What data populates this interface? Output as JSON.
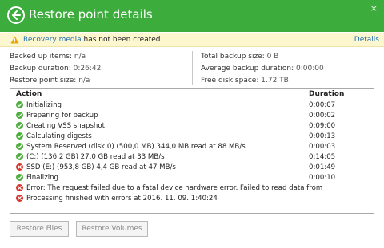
{
  "window": {
    "title": "Restore point details",
    "close_glyph": "×"
  },
  "notice": {
    "link_text": "Recovery media",
    "text": " has not been created",
    "details_label": "Details"
  },
  "summary": {
    "backed_up_items": {
      "label": "Backed up items:",
      "value": "n/a"
    },
    "backup_duration": {
      "label": "Backup duration:",
      "value": "0:26:42"
    },
    "restore_point_size": {
      "label": "Restore point size:",
      "value": "n/a"
    },
    "total_backup_size": {
      "label": "Total backup size:",
      "value": "0 B"
    },
    "average_backup_duration": {
      "label": "Average backup duration:",
      "value": "0:00:00"
    },
    "free_disk_space": {
      "label": "Free disk space:",
      "value": "1.72 TB"
    }
  },
  "log": {
    "columns": {
      "action": "Action",
      "duration": "Duration"
    },
    "rows": [
      {
        "status": "success",
        "text": "Initializing",
        "duration": "0:00:07"
      },
      {
        "status": "success",
        "text": "Preparing for backup",
        "duration": "0:00:02"
      },
      {
        "status": "success",
        "text": "Creating VSS snapshot",
        "duration": "0:09:00"
      },
      {
        "status": "success",
        "text": "Calculating digests",
        "duration": "0:00:13"
      },
      {
        "status": "success",
        "text": "System Reserved (disk 0) (500,0 MB) 344,0 MB read at 88 MB/s",
        "duration": "0:00:03"
      },
      {
        "status": "success",
        "text": "(C:) (136,2 GB) 27,0 GB read at 33 MB/s",
        "duration": "0:14:05"
      },
      {
        "status": "error",
        "text": "SSD (E:) (953,8 GB) 4,4 GB read at 47 MB/s",
        "duration": "0:01:49"
      },
      {
        "status": "success",
        "text": "Finalizing",
        "duration": "0:00:10"
      },
      {
        "status": "error",
        "text": "Error: The request failed due to a fatal device hardware error. Failed to read data from",
        "duration": ""
      },
      {
        "status": "error",
        "text": "Processing finished with errors at 2016. 11. 09. 1:40:24",
        "duration": ""
      }
    ]
  },
  "buttons": {
    "restore_files": "Restore Files",
    "restore_volumes": "Restore Volumes"
  },
  "colors": {
    "title_bar": "#3cac3c",
    "notice_bg": "#fcf7cf",
    "link": "#1f6eb5",
    "success": "#4caf3c",
    "error": "#d9342b",
    "warning": "#e8a400"
  }
}
